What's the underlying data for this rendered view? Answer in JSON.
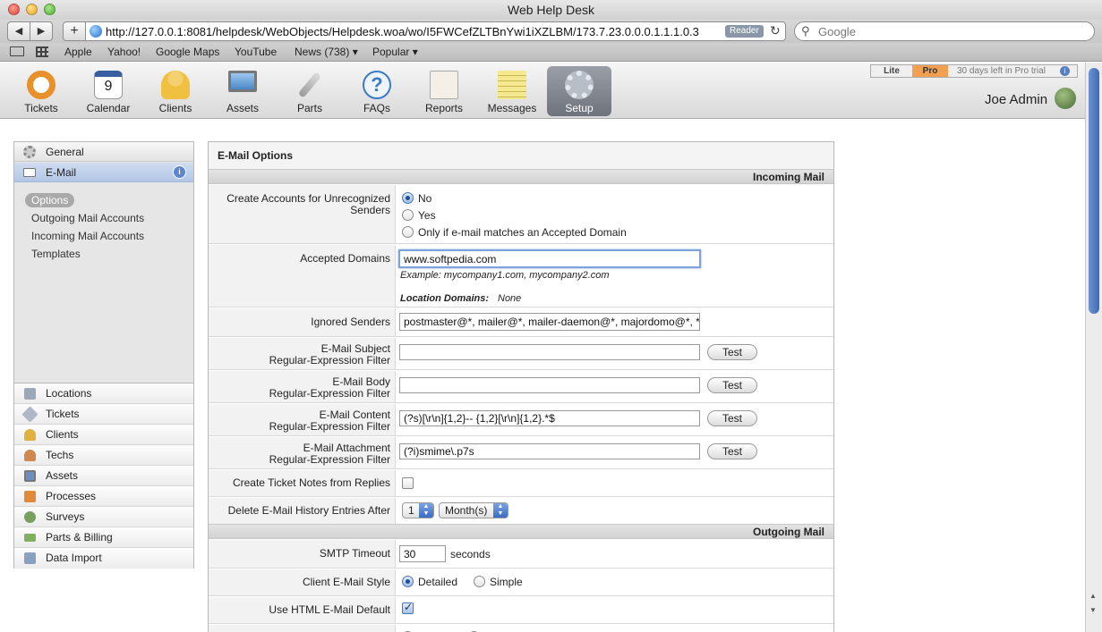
{
  "window": {
    "title": "Web Help Desk"
  },
  "browser": {
    "url": "http://127.0.0.1:8081/helpdesk/WebObjects/Helpdesk.woa/wo/I5FWCefZLTBnYwi1iXZLBM/173.7.23.0.0.0.1.1.1.0.3",
    "reader_label": "Reader",
    "search_placeholder": "Google",
    "back_glyph": "◀",
    "forward_glyph": "▶",
    "add_glyph": "+",
    "reload_glyph": "↻",
    "search_glyph": "⚲",
    "bookmarks": [
      "Apple",
      "Yahoo!",
      "Google Maps",
      "YouTube",
      "News (738) ▾",
      "Popular ▾"
    ]
  },
  "header": {
    "nav": [
      {
        "label": "Tickets",
        "icon": "lifebuoy-icon",
        "color": "#e8902a"
      },
      {
        "label": "Calendar",
        "icon": "calendar-icon",
        "color": "#d9d9d9",
        "glyph": "9"
      },
      {
        "label": "Clients",
        "icon": "person-icon",
        "color": "#f0c040"
      },
      {
        "label": "Assets",
        "icon": "monitor-icon",
        "color": "#6a9fd0"
      },
      {
        "label": "Parts",
        "icon": "wrench-icon",
        "color": "#b8b8b8"
      },
      {
        "label": "FAQs",
        "icon": "question-icon",
        "color": "#3a7ac8",
        "glyph": "?"
      },
      {
        "label": "Reports",
        "icon": "chart-icon",
        "color": "#d8d0c0"
      },
      {
        "label": "Messages",
        "icon": "note-icon",
        "color": "#f0e080"
      },
      {
        "label": "Setup",
        "icon": "gear-icon",
        "color": "#c8ccd4"
      }
    ],
    "trial": {
      "lite": "Lite",
      "pro": "Pro",
      "days_left": "30 days left in Pro trial",
      "info_glyph": "i"
    },
    "user_name": "Joe Admin"
  },
  "sidebar": {
    "top_items": [
      {
        "label": "General",
        "icon": "gear-icon"
      },
      {
        "label": "E-Mail",
        "icon": "envelope-icon"
      }
    ],
    "info_glyph": "i",
    "sub_items": [
      "Options",
      "Outgoing Mail Accounts",
      "Incoming Mail Accounts",
      "Templates"
    ],
    "lower_items": [
      {
        "label": "Locations",
        "icon": "building-icon",
        "color": "#9aa8b8"
      },
      {
        "label": "Tickets",
        "icon": "tag-icon",
        "color": "#b0b8c8"
      },
      {
        "label": "Clients",
        "icon": "person-icon",
        "color": "#e0b040"
      },
      {
        "label": "Techs",
        "icon": "tech-icon",
        "color": "#d08850"
      },
      {
        "label": "Assets",
        "icon": "monitor-icon",
        "color": "#6a8fc0"
      },
      {
        "label": "Processes",
        "icon": "flowchart-icon",
        "color": "#e08a3a"
      },
      {
        "label": "Surveys",
        "icon": "globe-icon",
        "color": "#7aa060"
      },
      {
        "label": "Parts & Billing",
        "icon": "money-icon",
        "color": "#80b060"
      },
      {
        "label": "Data Import",
        "icon": "import-icon",
        "color": "#8aa0c0"
      }
    ]
  },
  "panel": {
    "title": "E-Mail Options",
    "incoming_header": "Incoming Mail",
    "outgoing_header": "Outgoing Mail",
    "create_accounts": {
      "label": "Create Accounts for Unrecognized Senders",
      "options": [
        "No",
        "Yes",
        "Only if e-mail matches an Accepted Domain"
      ],
      "selected": "No"
    },
    "accepted_domains": {
      "label": "Accepted Domains",
      "value": "www.softpedia.com",
      "example": "Example: mycompany1.com, mycompany2.com",
      "location_label": "Location Domains:",
      "location_value": "None"
    },
    "ignored_senders": {
      "label": "Ignored Senders",
      "value": "postmaster@*, mailer@*, mailer-daemon@*, majordomo@*, *"
    },
    "filters": [
      {
        "label1": "E-Mail Subject",
        "label2": "Regular-Expression Filter",
        "value": "",
        "button": "Test"
      },
      {
        "label1": "E-Mail Body",
        "label2": "Regular-Expression Filter",
        "value": "",
        "button": "Test"
      },
      {
        "label1": "E-Mail Content",
        "label2": "Regular-Expression Filter",
        "value": "(?s)[\\r\\n]{1,2}-- {1,2}[\\r\\n]{1,2}.*$",
        "button": "Test"
      },
      {
        "label1": "E-Mail Attachment",
        "label2": "Regular-Expression Filter",
        "value": "(?i)smime\\.p7s",
        "button": "Test"
      }
    ],
    "ticket_notes": {
      "label": "Create Ticket Notes from Replies",
      "checked": false
    },
    "delete_history": {
      "label": "Delete E-Mail History Entries After",
      "count": "1",
      "unit": "Month(s)"
    },
    "smtp_timeout": {
      "label": "SMTP Timeout",
      "value": "30",
      "unit": "seconds"
    },
    "client_style": {
      "label": "Client E-Mail Style",
      "options": [
        "Detailed",
        "Simple"
      ],
      "selected": "Detailed"
    },
    "html_default": {
      "label": "Use HTML E-Mail Default",
      "checked": true
    }
  }
}
